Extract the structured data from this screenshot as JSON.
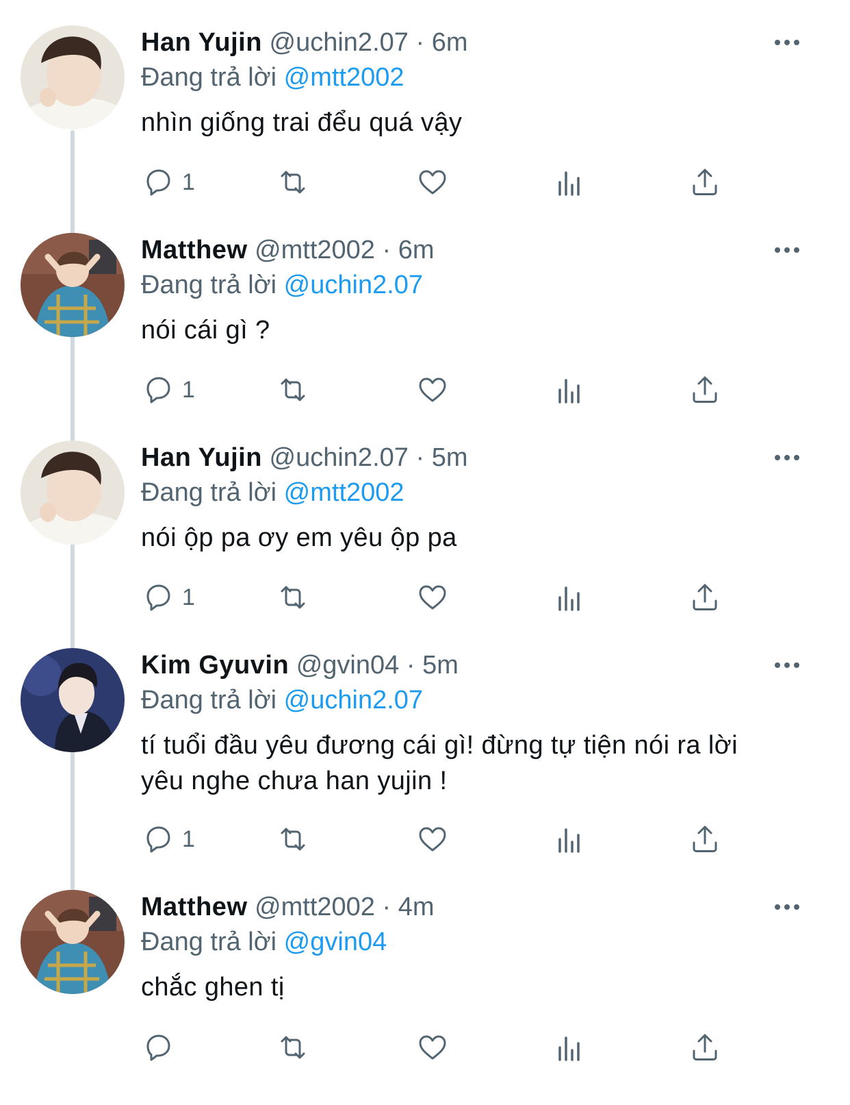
{
  "reply_prefix": "Đang trả lời",
  "colors": {
    "mention": "#1d9bf0",
    "secondary": "#536471",
    "text": "#0f1419"
  },
  "tweets": [
    {
      "name": "Han Yujin",
      "handle": "@uchin2.07",
      "dot": "·",
      "time": "6m",
      "replying_to": "@mtt2002",
      "text": "nhìn giống trai đểu quá vậy",
      "reply_count": "1"
    },
    {
      "name": "Matthew",
      "handle": "@mtt2002",
      "dot": "·",
      "time": "6m",
      "replying_to": "@uchin2.07",
      "text": "nói cái gì ?",
      "reply_count": "1"
    },
    {
      "name": "Han Yujin",
      "handle": "@uchin2.07",
      "dot": "·",
      "time": "5m",
      "replying_to": "@mtt2002",
      "text": "nói ộp pa ơy em yêu ộp pa",
      "reply_count": "1"
    },
    {
      "name": "Kim Gyuvin",
      "handle": "@gvin04",
      "dot": "·",
      "time": "5m",
      "replying_to": "@uchin2.07",
      "text_line1": "tí tuổi đầu yêu đương cái gì! đừng tự tiện nói ra lời",
      "text_line2": "yêu nghe chưa han yujin !",
      "reply_count": "1"
    },
    {
      "name": "Matthew",
      "handle": "@mtt2002",
      "dot": "·",
      "time": "4m",
      "replying_to": "@gvin04",
      "text": "chắc ghen tị",
      "reply_count": ""
    }
  ]
}
